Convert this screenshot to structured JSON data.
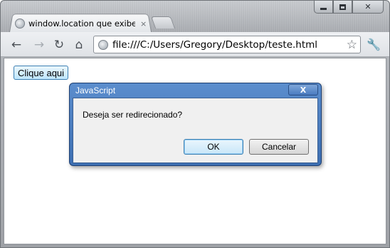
{
  "browser": {
    "tab_title": "window.location que exibe",
    "tab_close": "×",
    "url": "file:///C:/Users/Gregory/Desktop/teste.html",
    "icons": {
      "back": "back-arrow-icon",
      "forward": "forward-arrow-icon",
      "reload": "reload-icon",
      "home": "home-icon",
      "bookmark": "star-icon",
      "menu": "wrench-icon"
    }
  },
  "page": {
    "button_label": "Clique aqui"
  },
  "dialog": {
    "title": "JavaScript",
    "close_label": "X",
    "message": "Deseja ser redirecionado?",
    "ok_label": "OK",
    "cancel_label": "Cancelar"
  },
  "colors": {
    "dialog_frame": "#4a7bc0",
    "button_accent": "#3c7fb1"
  }
}
